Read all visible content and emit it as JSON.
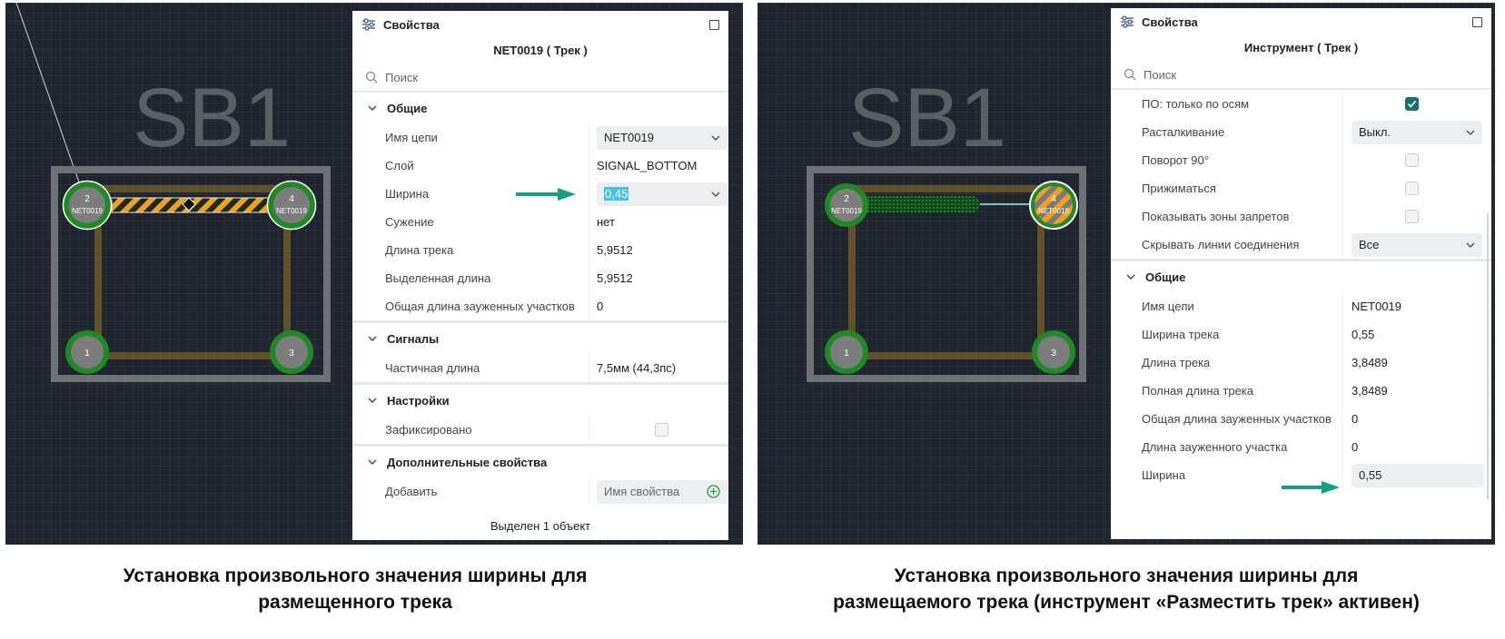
{
  "left": {
    "canvas": {
      "designator": "SB1",
      "pads": [
        {
          "num": "2",
          "net": "NET0019"
        },
        {
          "num": "4",
          "net": "NET0019"
        },
        {
          "num": "1",
          "net": ""
        },
        {
          "num": "3",
          "net": ""
        }
      ]
    },
    "panel": {
      "title": "Свойства",
      "subtitle": "NET0019 ( Трек )",
      "search_placeholder": "Поиск",
      "sections": {
        "general": {
          "title": "Общие",
          "net_name_label": "Имя цепи",
          "net_name_value": "NET0019",
          "layer_label": "Слой",
          "layer_value": "SIGNAL_BOTTOM",
          "width_label": "Ширина",
          "width_value": "0,45",
          "neck_label": "Сужение",
          "neck_value": "нет",
          "track_len_label": "Длина трека",
          "track_len_value": "5,9512",
          "sel_len_label": "Выделенная длина",
          "sel_len_value": "5,9512",
          "neck_total_label": "Общая длина зауженных участков",
          "neck_total_value": "0"
        },
        "signals": {
          "title": "Сигналы",
          "partial_label": "Частичная длина",
          "partial_value": "7,5мм (44,3пс)"
        },
        "settings": {
          "title": "Настройки",
          "locked_label": "Зафиксировано"
        },
        "extra": {
          "title": "Дополнительные свойства",
          "add_label": "Добавить",
          "add_placeholder": "Имя свойства"
        }
      },
      "footer": "Выделен 1 объект"
    },
    "caption_line1": "Установка произвольного значения ширины для",
    "caption_line2": "размещенного трека"
  },
  "right": {
    "canvas": {
      "designator": "SB1",
      "pads": [
        {
          "num": "2",
          "net": "NET0019"
        },
        {
          "num": "4",
          "net": "NET0019"
        },
        {
          "num": "1",
          "net": ""
        },
        {
          "num": "3",
          "net": ""
        }
      ]
    },
    "panel": {
      "title": "Свойства",
      "subtitle": "Инструмент ( Трек )",
      "search_placeholder": "Поиск",
      "tool": {
        "axes_label": "ПО: только по осям",
        "push_label": "Расталкивание",
        "push_value": "Выкл.",
        "rot_label": "Поворот 90°",
        "hug_label": "Прижиматься",
        "keepout_label": "Показывать зоны запретов",
        "hide_label": "Скрывать линии соединения",
        "hide_value": "Все"
      },
      "general": {
        "title": "Общие",
        "net_name_label": "Имя цепи",
        "net_name_value": "NET0019",
        "track_width_label": "Ширина трека",
        "track_width_value": "0,55",
        "track_len_label": "Длина трека",
        "track_len_value": "3,8489",
        "full_len_label": "Полная длина трека",
        "full_len_value": "3,8489",
        "neck_total_label": "Общая длина зауженных участков",
        "neck_total_value": "0",
        "neck_len_label": "Длина зауженного участка",
        "neck_len_value": "0",
        "width_label": "Ширина",
        "width_value": "0,55"
      }
    },
    "caption_line1": "Установка произвольного значения ширины для",
    "caption_line2": "размещаемого трека (инструмент «Разместить трек» активен)"
  },
  "colors": {
    "canvas_bg": "#1f252e",
    "pad_ring": "#1d8a24",
    "track_orange": "#f0a020",
    "accent_arrow": "#12a082",
    "checkbox_on": "#19706a"
  }
}
